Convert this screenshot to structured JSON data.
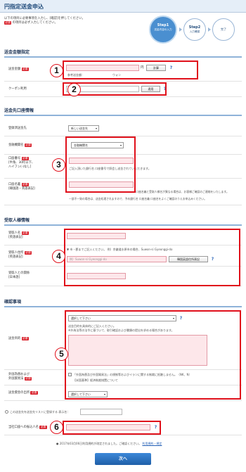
{
  "page": {
    "title": "円指定送金申込"
  },
  "intro": {
    "line1": "以下の項目に必要事項を入力し、[確認]を押してください。",
    "line2_rest": "の項目は必ず入力してください。",
    "required_tag": "必須"
  },
  "steps": [
    {
      "num": "Step1",
      "label": "送金内容の入力"
    },
    {
      "num": "Step2",
      "label": "入力確認"
    },
    {
      "num": "",
      "label": "完了"
    }
  ],
  "sections": {
    "amount": "送金金額指定",
    "account": "送金先口座情報",
    "recipient": "受取人様情報",
    "confirm": "確認事項"
  },
  "amount": {
    "label": "送金金額",
    "unit": "円",
    "calc_button": "計算",
    "ref_label": "参考送金額：",
    "ref_unit": "ウォン",
    "coupon_label": "クーポン利用",
    "apply_button": "適用"
  },
  "account": {
    "registered_label": "登録済送金先",
    "registered_value": "新しい送金先",
    "bank_label": "金融機関名",
    "bank_value": "金融機関名",
    "acct_no_label": "口座番号",
    "acct_no_note1": "[半角、30桁以下、",
    "acct_no_note2": "ハイフン(-)なし]",
    "acct_no_hint": "ご記入頂いた銀行名 口座番号で照会し送金されていただきます。",
    "acct_name_label": "口座名義",
    "acct_name_note": "[韓国語・英語表記]",
    "notice1": "※口座名義と受取人様名が異なる場合は、お客様ご確認のご連絡をいたします。",
    "notice2": "一部不一致の場合は、送金処理されますので、予め銀行名 口座名義 口座名をよくご確認のうえお申込みください。"
  },
  "recipient": {
    "name_label": "受取人名",
    "name_note": "[英語表記]",
    "addr_label": "受取人住所",
    "addr_note": "[英語表記]",
    "addr_hint": "▼ 市・郡までご記入ください。 例）京畿道水原市の場合、Suwon-si Gyeonggi-do",
    "addr_placeholder": "例）Suwon-si Gyeonggi-do",
    "addr_button": "韓国英語住所表記",
    "relation_label": "受取人との関係",
    "relation_note": "[日本語]"
  },
  "confirm": {
    "purpose_label": "送金目的",
    "purpose_value": "選択して下さい",
    "purpose_hint1": "送金目的を具体的にご記入ください。",
    "purpose_hint2": "※外為法等の法令に基づいて、取引確認および書類の提出を求める場合があります。",
    "foreign_label1": "外国為替および",
    "foreign_label2": "外国貿易法",
    "foreign_text": "「外国為替及び外国貿易法」の規制等およびイランに関する制裁に抵触しません。（NK、N）",
    "foreign_sub": "【米国基準】経済制裁措置について",
    "fund_label": "送金資金の出所",
    "fund_value": "選択して下さい",
    "register_text": "この送金先を送金先リストに登録する 表示名：",
    "name_label": "当社口座への振込人名",
    "footer_note": "● 2017年03月06日利用規約が改定されました。ご確認ください。",
    "footer_link": "利用規約・規定"
  },
  "markers": [
    "1",
    "2",
    "3",
    "4",
    "5",
    "6"
  ],
  "help_mark": "?",
  "next_button": "次へ",
  "colors": {
    "accent_red": "#e0101b",
    "brand_blue": "#1f4a7a",
    "input_pink": "#fde7ea"
  }
}
